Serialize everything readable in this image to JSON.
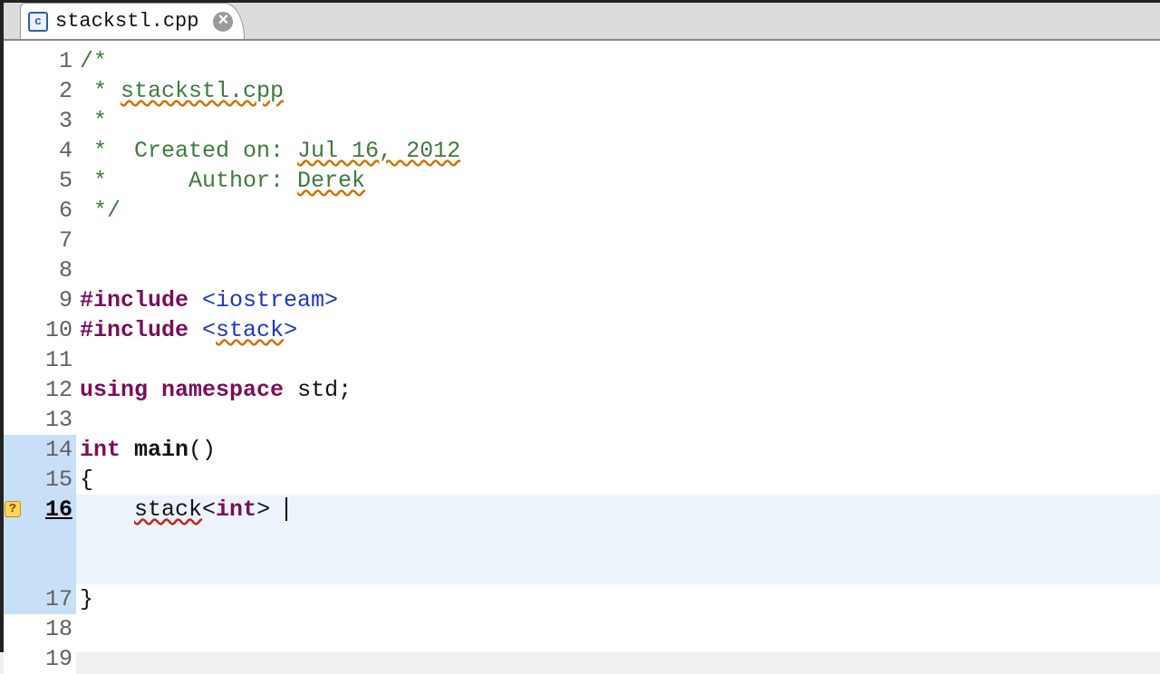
{
  "tab": {
    "icon_letter": "c",
    "filename": "stackstl.cpp",
    "close_glyph": "×"
  },
  "warning_marker": {
    "glyph": "?"
  },
  "lines": {
    "l1": {
      "num": "1",
      "comment": "/*"
    },
    "l2": {
      "num": "2",
      "comment_pre": " * ",
      "comment_text": "stackstl.cpp"
    },
    "l3": {
      "num": "3",
      "comment": " *"
    },
    "l4": {
      "num": "4",
      "comment_pre": " *  Created on: ",
      "comment_text": "Jul 16, 2012"
    },
    "l5": {
      "num": "5",
      "comment_pre": " *      Author: ",
      "comment_text": "Derek"
    },
    "l6": {
      "num": "6",
      "comment": " */"
    },
    "l7": {
      "num": "7"
    },
    "l8": {
      "num": "8"
    },
    "l9": {
      "num": "9",
      "kw": "#include",
      "str": " <iostream>"
    },
    "l10": {
      "num": "10",
      "kw": "#include",
      "str_open": " <",
      "str_text": "stack",
      "str_close": ">"
    },
    "l11": {
      "num": "11"
    },
    "l12": {
      "num": "12",
      "kw1": "using",
      "sp1": " ",
      "kw2": "namespace",
      "sp2": " ",
      "id": "std",
      "tail": ";"
    },
    "l13": {
      "num": "13"
    },
    "l14": {
      "num": "14",
      "kw": "int",
      "sp": " ",
      "fn": "main",
      "tail": "()"
    },
    "l15": {
      "num": "15",
      "text": "{"
    },
    "l16": {
      "num": "16",
      "indent": "    ",
      "id": "stack",
      "tmpl_open": "<",
      "tmpl_kw": "int",
      "tmpl_close": ">",
      "tail": " "
    },
    "l17": {
      "num": "17",
      "text": "}"
    },
    "l18": {
      "num": "18"
    },
    "l19": {
      "num": "19"
    }
  }
}
